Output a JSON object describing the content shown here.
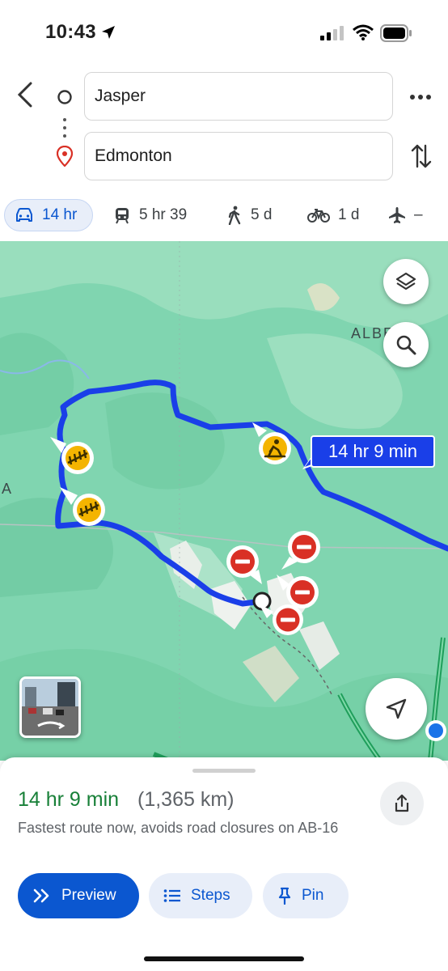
{
  "status_bar": {
    "time": "10:43"
  },
  "directions": {
    "origin": "Jasper",
    "destination": "Edmonton"
  },
  "modes": [
    {
      "name": "driving",
      "label": "14 hr",
      "selected": true
    },
    {
      "name": "transit",
      "label": "5 hr 39"
    },
    {
      "name": "walking",
      "label": "5 d"
    },
    {
      "name": "cycling",
      "label": "1 d"
    },
    {
      "name": "flight",
      "label": "–"
    }
  ],
  "map": {
    "route_label": "14 hr 9 min",
    "place_label_1": "ALBE",
    "place_label_2": "A",
    "route_color": "#1a3fe8"
  },
  "summary": {
    "duration": "14 hr 9 min",
    "distance": "(1,365 km)",
    "description": "Fastest route now, avoids road closures on AB-16"
  },
  "actions": {
    "preview": "Preview",
    "steps": "Steps",
    "pin": "Pin"
  }
}
